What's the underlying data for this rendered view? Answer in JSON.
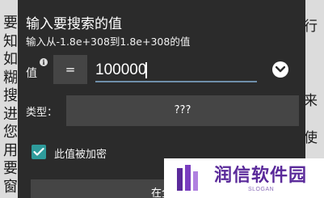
{
  "background": {
    "left_chars": [
      "要",
      "知",
      "如",
      "糊",
      "搜",
      "进",
      "您",
      "用",
      "要",
      "窗"
    ],
    "right_chars": [
      "行",
      "",
      "",
      "",
      "来",
      "",
      "使",
      "",
      ""
    ]
  },
  "dialog": {
    "title": "输入要搜索的值",
    "subtitle": "输入从-1.8e+308到1.8e+308的值",
    "value_label": "值",
    "info_icon": "i",
    "operator": "=",
    "value_input": "100000",
    "dropdown_icon": "chevron-down-icon",
    "type_label": "类型：",
    "type_value": "???",
    "checkbox_checked": true,
    "checkbox_label": "此值被加密",
    "bottom_button": "在全部"
  },
  "watermark": {
    "title": "润信软件园",
    "slogan": "SLOGAN"
  },
  "colors": {
    "dialog_bg": "#2b2b2b",
    "button_bg": "#454545",
    "checkbox": "#2e9b9b",
    "underline": "#6f8faa",
    "watermark_text": "#5a2a9a"
  }
}
